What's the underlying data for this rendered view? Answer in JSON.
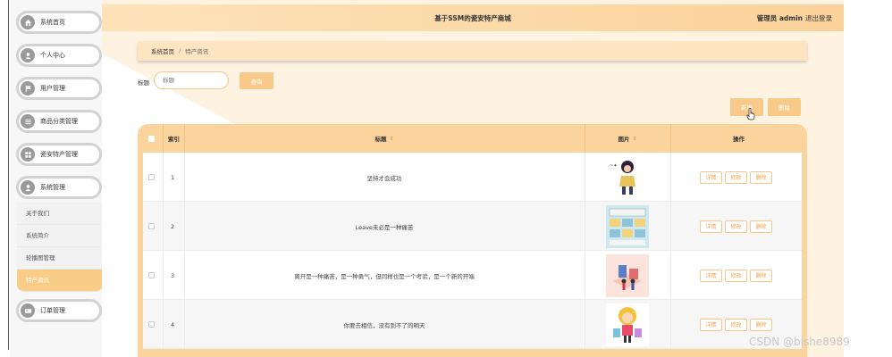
{
  "app": {
    "title": "基于SSM的瓷安特产商城"
  },
  "header": {
    "user_label": "管理员 admin",
    "logout": "退出登录"
  },
  "sidebar": {
    "items": [
      {
        "label": "系统首页",
        "icon": "home-icon"
      },
      {
        "label": "个人中心",
        "icon": "user-icon"
      },
      {
        "label": "用户管理",
        "icon": "flag-icon"
      },
      {
        "label": "商品分类管理",
        "icon": "list-icon"
      },
      {
        "label": "瓷安特产管理",
        "icon": "grid-icon"
      },
      {
        "label": "系统管理",
        "icon": "user-icon"
      },
      {
        "label": "订单管理",
        "icon": "card-icon"
      }
    ],
    "submenu": [
      "关于我们",
      "系统简介",
      "轮播图管理",
      "特产资讯"
    ]
  },
  "breadcrumb": {
    "home": "系统首页",
    "separator": "/",
    "current": "特产资讯"
  },
  "search": {
    "label": "标题",
    "placeholder": "标题",
    "button": "查询"
  },
  "actions": {
    "add": "新增",
    "delete": "删除"
  },
  "table": {
    "columns": [
      "索引",
      "标题",
      "图片",
      "操作"
    ],
    "rows": [
      {
        "index": "1",
        "title": "坚持才会成功"
      },
      {
        "index": "2",
        "title": "Leave未必是一种痛苦"
      },
      {
        "index": "3",
        "title": "离开是一种痛苦，是一种勇气，但同样也是一个考验，是一个新的开端"
      },
      {
        "index": "4",
        "title": "你要去相信，没有到不了的明天"
      }
    ],
    "row_ops": [
      "详情",
      "修改",
      "删除"
    ]
  },
  "watermark": "CSDN @bishe8989",
  "colors": {
    "accent": "#f9c98a",
    "header_bg": "#fbd39c",
    "topbar": "#fde2b9"
  }
}
